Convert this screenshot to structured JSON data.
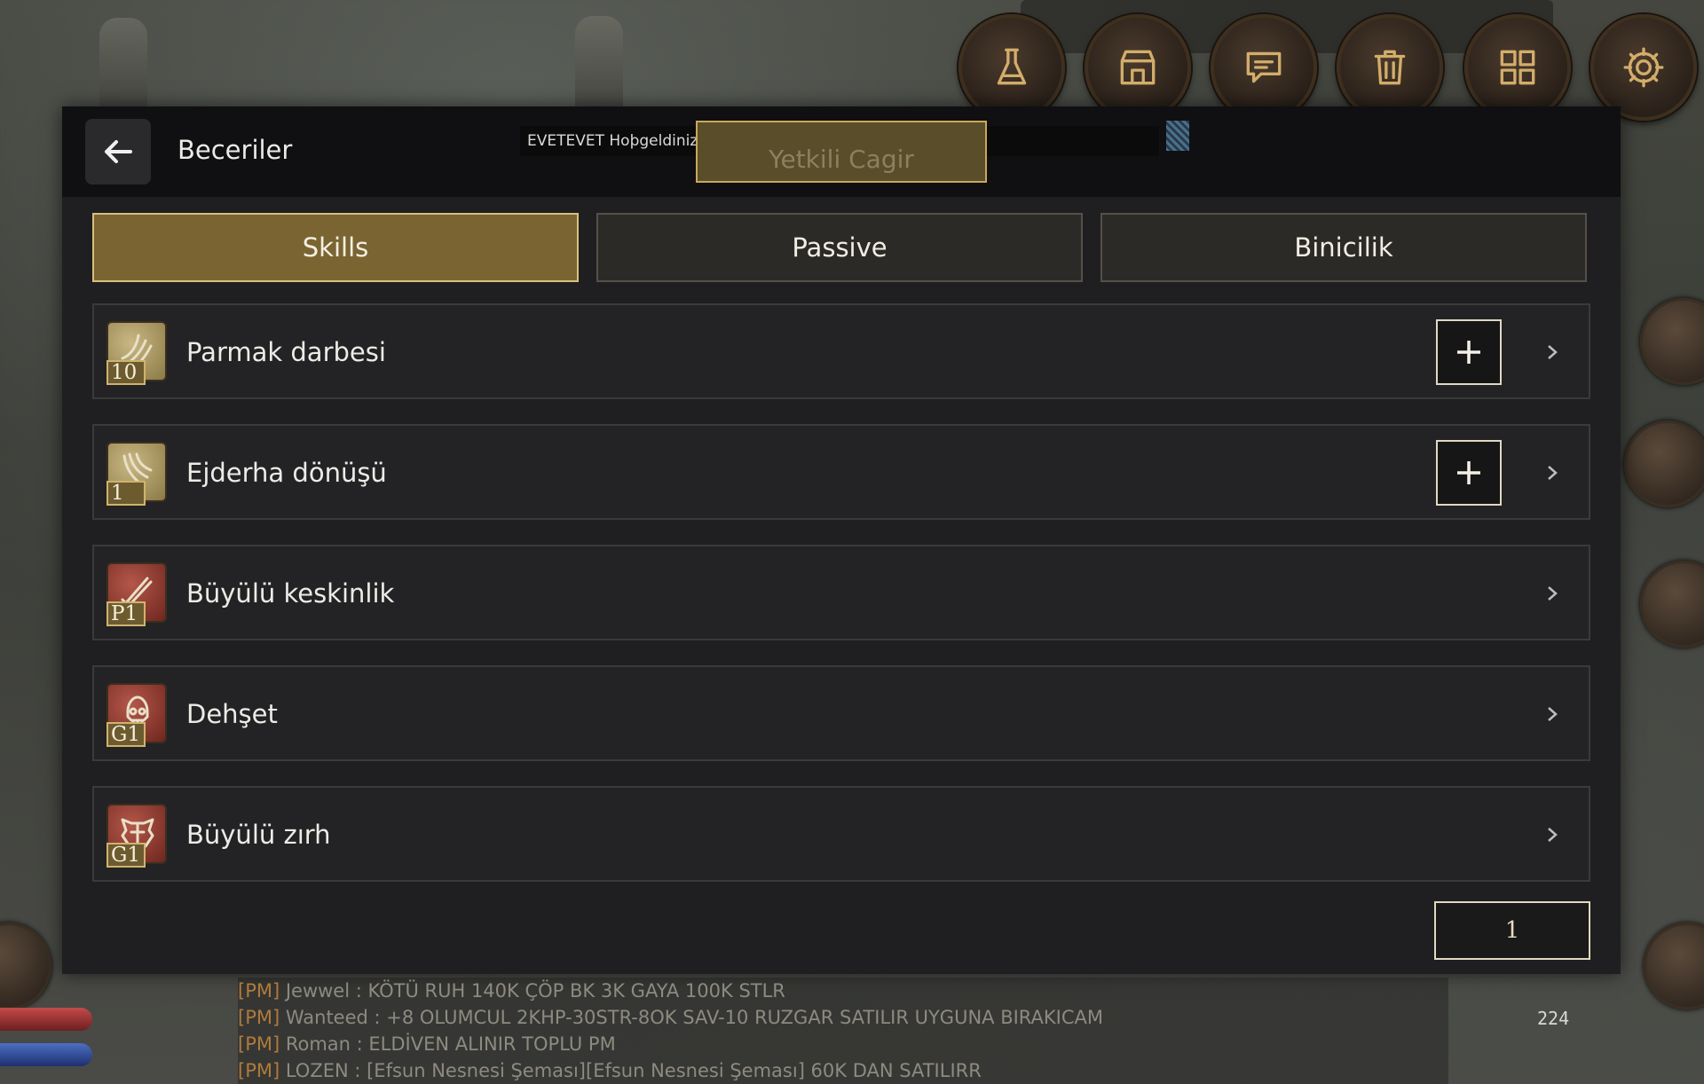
{
  "top_buttons": [
    {
      "name": "potion-icon"
    },
    {
      "name": "shop-icon"
    },
    {
      "name": "chat-icon"
    },
    {
      "name": "trash-icon"
    },
    {
      "name": "grid-icon"
    },
    {
      "name": "gear-icon"
    }
  ],
  "header": {
    "title": "Beceriler",
    "welcome_text": "EVETEVET Hoþgeldiniz.",
    "call_button": "Yetkili Cagir"
  },
  "tabs": [
    {
      "label": "Skills",
      "active": true
    },
    {
      "label": "Passive",
      "active": false
    },
    {
      "label": "Binicilik",
      "active": false
    }
  ],
  "skills": [
    {
      "name": "Parmak darbesi",
      "level": "10",
      "has_plus": true,
      "icon": "claw-icon",
      "icon_color": "#8a7a45"
    },
    {
      "name": "Ejderha dönüşü",
      "level": "1",
      "has_plus": true,
      "icon": "wing-icon",
      "icon_color": "#8a7a45"
    },
    {
      "name": "Büyülü keskinlik",
      "level": "P1",
      "has_plus": false,
      "icon": "blade-icon",
      "icon_color": "#7a2e24"
    },
    {
      "name": "Dehşet",
      "level": "G1",
      "has_plus": false,
      "icon": "skull-icon",
      "icon_color": "#7a2e24"
    },
    {
      "name": "Büyülü zırh",
      "level": "G1",
      "has_plus": false,
      "icon": "armor-icon",
      "icon_color": "#7a2e24"
    }
  ],
  "pagination": {
    "page": "1"
  },
  "chat": [
    {
      "tag": "[PM]",
      "text": " Jewwel :  KÖTÜ RUH 140K ÇÖP BK 3K GAYA 100K STLR"
    },
    {
      "tag": "[PM]",
      "text": " Wanteed : +8 OLUMCUL 2KHP-30STR-8OK SAV-10 RUZGAR SATILIR  UYGUNA BIRAKICAM"
    },
    {
      "tag": "[PM]",
      "text": " Roman : ELDİVEN ALINIR TOPLU PM"
    },
    {
      "tag": "[PM]",
      "text": " LOZEN : [Efsun Nesnesi Şeması][Efsun Nesnesi Şeması] 60K DAN SATILIRR"
    }
  ],
  "hud": {
    "counter": "224"
  },
  "colors": {
    "accent": "#7a6532",
    "accent_border": "#d7c07e",
    "panel": "#1f1f21",
    "header": "#101012"
  }
}
